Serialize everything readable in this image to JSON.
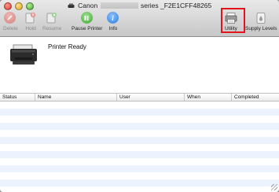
{
  "window": {
    "title_prefix": "Canon",
    "title_suffix": "series _F2E1CFF48265"
  },
  "toolbar": {
    "delete_label": "Delete",
    "hold_label": "Hold",
    "resume_label": "Resume",
    "pause_label": "Pause Printer",
    "info_label": "Info",
    "utility_label": "Utility",
    "supply_label": "Supply Levels"
  },
  "printer": {
    "status": "Printer Ready"
  },
  "queue": {
    "columns": [
      "Status",
      "Name",
      "User",
      "When",
      "Completed"
    ],
    "rows": []
  },
  "colors": {
    "highlight": "#e3141b",
    "pause_green": "#3eaa2f",
    "info_blue": "#2a7ad8",
    "delete_red": "#d96a63"
  }
}
